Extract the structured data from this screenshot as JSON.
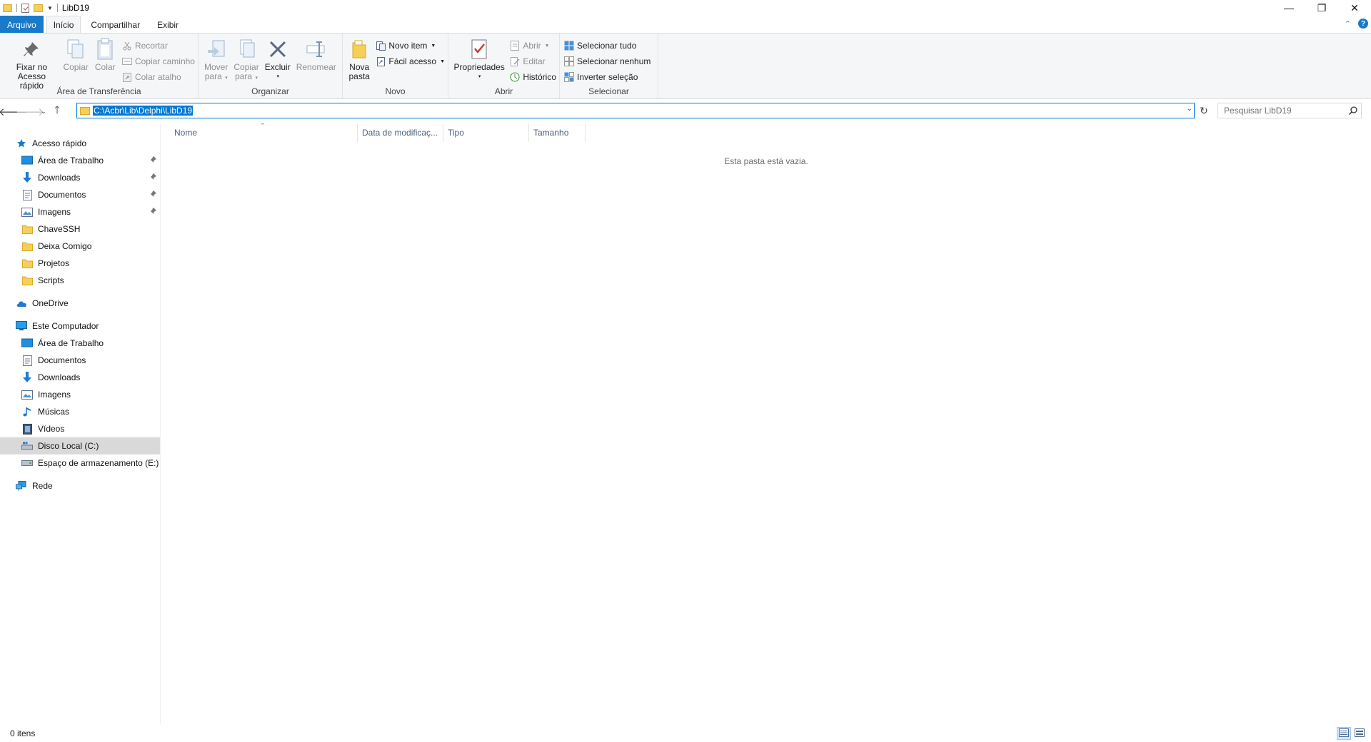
{
  "window": {
    "title": "LibD19",
    "controls": {
      "minimize": "—",
      "maximize": "❐",
      "close": "✕"
    }
  },
  "tabs": {
    "file": "Arquivo",
    "home": "Início",
    "share": "Compartilhar",
    "view": "Exibir"
  },
  "ribbon": {
    "clipboard": {
      "label": "Área de Transferência",
      "pin_line1": "Fixar no",
      "pin_line2": "Acesso rápido",
      "copy": "Copiar",
      "paste": "Colar",
      "cut": "Recortar",
      "copy_path": "Copiar caminho",
      "paste_shortcut": "Colar atalho"
    },
    "organize": {
      "label": "Organizar",
      "move_line1": "Mover",
      "move_line2": "para",
      "copyto_line1": "Copiar",
      "copyto_line2": "para",
      "delete": "Excluir",
      "rename": "Renomear"
    },
    "new": {
      "label": "Novo",
      "new_folder_line1": "Nova",
      "new_folder_line2": "pasta",
      "new_item": "Novo item",
      "easy_access": "Fácil acesso"
    },
    "open": {
      "label": "Abrir",
      "properties": "Propriedades",
      "open": "Abrir",
      "edit": "Editar",
      "history": "Histórico"
    },
    "select": {
      "label": "Selecionar",
      "select_all": "Selecionar tudo",
      "select_none": "Selecionar nenhum",
      "invert": "Inverter seleção"
    }
  },
  "address": {
    "path": "C:\\Acbr\\Lib\\Delphi\\LibD19",
    "search_placeholder": "Pesquisar LibD19"
  },
  "nav": {
    "quick_access": "Acesso rápido",
    "quick_items": [
      "Área de Trabalho",
      "Downloads",
      "Documentos",
      "Imagens",
      "ChaveSSH",
      "Deixa Comigo",
      "Projetos",
      "Scripts"
    ],
    "onedrive": "OneDrive",
    "this_pc": "Este Computador",
    "pc_items": [
      "Área de Trabalho",
      "Documentos",
      "Downloads",
      "Imagens",
      "Músicas",
      "Vídeos",
      "Disco Local (C:)",
      "Espaço de armazenamento (E:)"
    ],
    "network": "Rede"
  },
  "columns": {
    "name": "Nome",
    "modified": "Data de modificaç...",
    "type": "Tipo",
    "size": "Tamanho"
  },
  "content": {
    "empty_message": "Esta pasta está vazia."
  },
  "status": {
    "item_count": "0 itens"
  },
  "colors": {
    "accent": "#1979ca",
    "folder": "#f6cf57",
    "selection": "#0078d7"
  }
}
